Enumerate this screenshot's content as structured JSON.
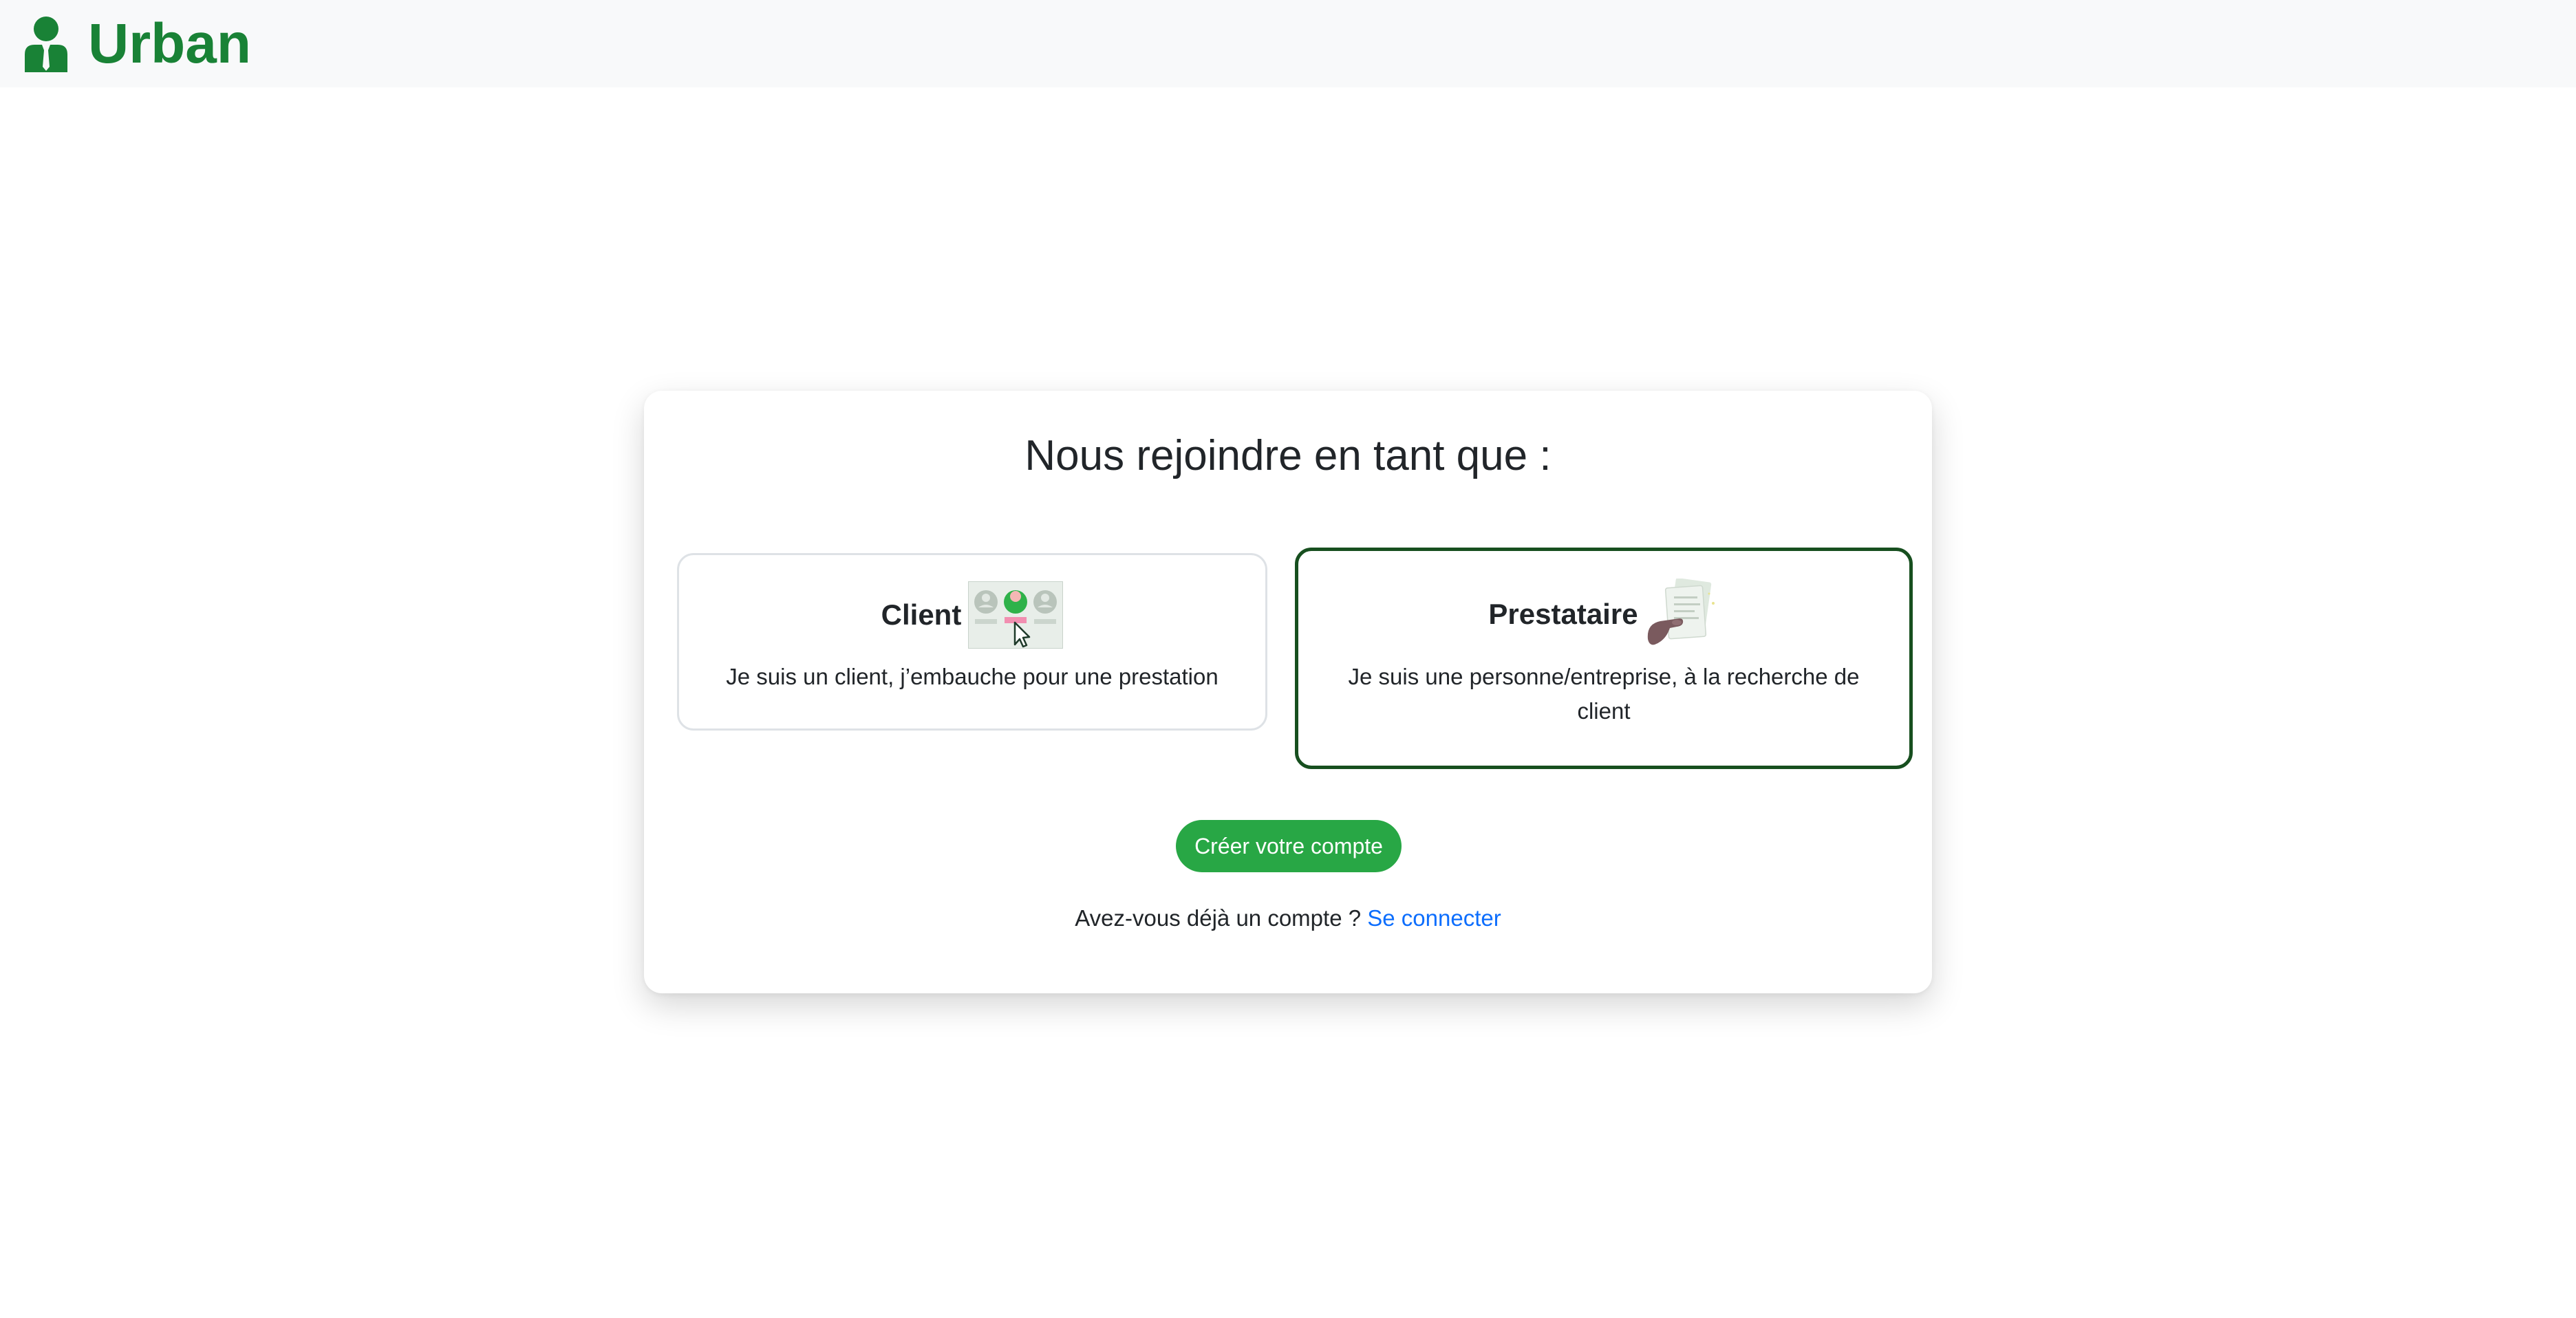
{
  "header": {
    "brand_name": "Urban",
    "brand_icon": "user-tie-icon",
    "brand_color": "#198236"
  },
  "card": {
    "title": "Nous rejoindre en tant que :",
    "options": [
      {
        "label": "Client",
        "description": "Je suis un client, j’embauche pour une prestation",
        "icon": "client-selection-illustration",
        "selected": false
      },
      {
        "label": "Prestataire",
        "description": "Je suis une personne/entreprise, à la recherche de client",
        "icon": "provider-documents-illustration",
        "selected": true
      }
    ],
    "submit_label": "Créer votre compte",
    "login_prompt": "Avez-vous déjà un compte ?",
    "login_link": "Se connecter"
  },
  "colors": {
    "accent": "#28a745",
    "selected_border": "#174f1f",
    "link": "#0d6efd",
    "navbar_bg": "#f8f9fa"
  }
}
